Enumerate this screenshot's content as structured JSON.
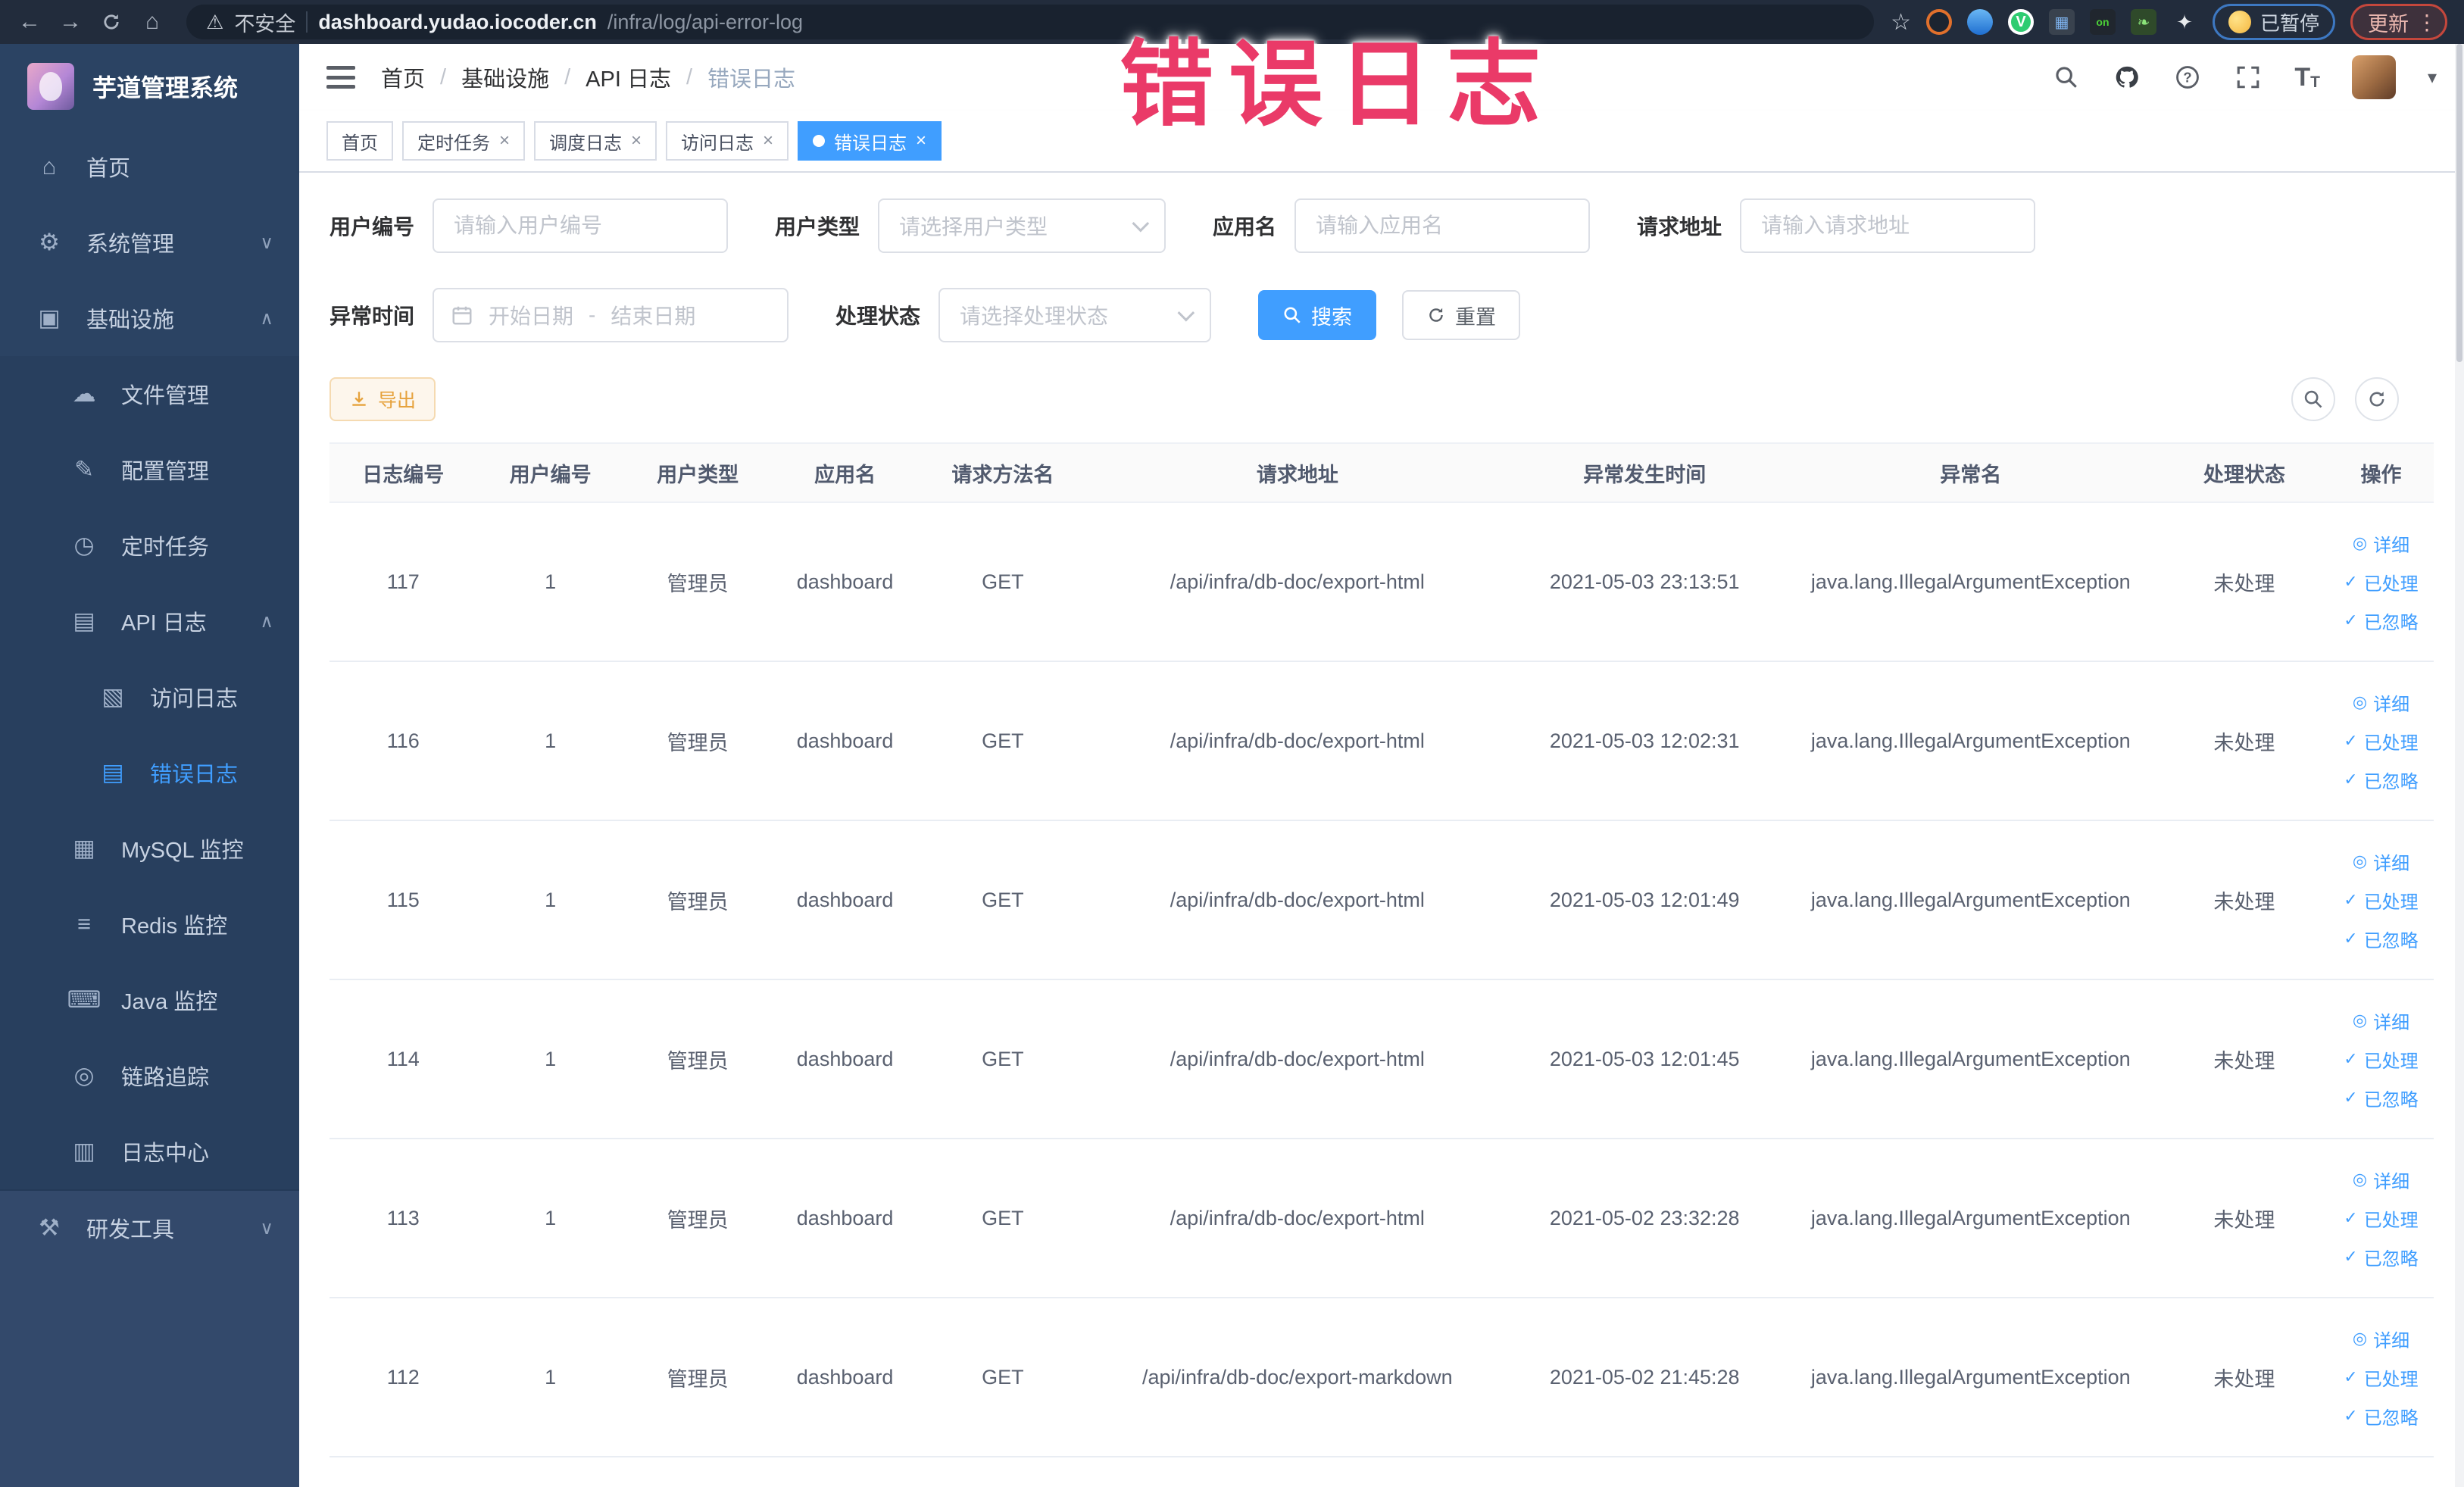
{
  "overlay": {
    "text": "错误日志",
    "color": "#ea3a68"
  },
  "colors": {
    "accent": "#409eff",
    "warning": "#e6a23c",
    "sidebar_bg": "#2b4363",
    "tag_active": "#409eff"
  },
  "browser": {
    "security_label": "不安全",
    "url_host": "dashboard.yudao.iocoder.cn",
    "url_path": "/infra/log/api-error-log",
    "paused_label": "已暂停",
    "update_label": "更新",
    "extension_badge": "on"
  },
  "sidebar": {
    "app_title": "芋道管理系统",
    "items": [
      {
        "key": "home",
        "label": "首页",
        "level": 0
      },
      {
        "key": "system-manage",
        "label": "系统管理",
        "level": 0,
        "arrow": "down"
      },
      {
        "key": "infra",
        "label": "基础设施",
        "level": 0,
        "arrow": "up"
      },
      {
        "key": "file-manage",
        "label": "文件管理",
        "level": 1
      },
      {
        "key": "config-manage",
        "label": "配置管理",
        "level": 1
      },
      {
        "key": "cron-job",
        "label": "定时任务",
        "level": 1
      },
      {
        "key": "api-log",
        "label": "API 日志",
        "level": 1,
        "arrow": "up"
      },
      {
        "key": "access-log",
        "label": "访问日志",
        "level": 2
      },
      {
        "key": "error-log",
        "label": "错误日志",
        "level": 2,
        "active": true
      },
      {
        "key": "mysql-monitor",
        "label": "MySQL 监控",
        "level": 1
      },
      {
        "key": "redis-monitor",
        "label": "Redis 监控",
        "level": 1
      },
      {
        "key": "java-monitor",
        "label": "Java 监控",
        "level": 1
      },
      {
        "key": "trace",
        "label": "链路追踪",
        "level": 1
      },
      {
        "key": "log-center",
        "label": "日志中心",
        "level": 1
      },
      {
        "key": "dev-tools",
        "label": "研发工具",
        "level": 0,
        "arrow": "down",
        "light": true
      }
    ]
  },
  "header": {
    "breadcrumb": [
      "首页",
      "基础设施",
      "API 日志",
      "错误日志"
    ]
  },
  "tabs": [
    {
      "label": "首页",
      "closable": false,
      "active": false
    },
    {
      "label": "定时任务",
      "closable": true,
      "active": false
    },
    {
      "label": "调度日志",
      "closable": true,
      "active": false
    },
    {
      "label": "访问日志",
      "closable": true,
      "active": false
    },
    {
      "label": "错误日志",
      "closable": true,
      "active": true
    }
  ],
  "filters": {
    "user_id": {
      "label": "用户编号",
      "placeholder": "请输入用户编号"
    },
    "user_type": {
      "label": "用户类型",
      "placeholder": "请选择用户类型"
    },
    "app_name": {
      "label": "应用名",
      "placeholder": "请输入应用名"
    },
    "request_url": {
      "label": "请求地址",
      "placeholder": "请输入请求地址"
    },
    "exception_time": {
      "label": "异常时间",
      "start_placeholder": "开始日期",
      "separator": "-",
      "end_placeholder": "结束日期"
    },
    "process_status": {
      "label": "处理状态",
      "placeholder": "请选择处理状态"
    },
    "search_label": "搜索",
    "reset_label": "重置"
  },
  "toolbar": {
    "export_label": "导出"
  },
  "table": {
    "columns": [
      "日志编号",
      "用户编号",
      "用户类型",
      "应用名",
      "请求方法名",
      "请求地址",
      "异常发生时间",
      "异常名",
      "处理状态",
      "操作"
    ],
    "row_actions": [
      "详细",
      "已处理",
      "已忽略"
    ],
    "rows": [
      {
        "log_id": "117",
        "user_id": "1",
        "user_type": "管理员",
        "app_name": "dashboard",
        "method": "GET",
        "url": "/api/infra/db-doc/export-html",
        "time": "2021-05-03 23:13:51",
        "exception": "java.lang.IllegalArgumentException",
        "status": "未处理"
      },
      {
        "log_id": "116",
        "user_id": "1",
        "user_type": "管理员",
        "app_name": "dashboard",
        "method": "GET",
        "url": "/api/infra/db-doc/export-html",
        "time": "2021-05-03 12:02:31",
        "exception": "java.lang.IllegalArgumentException",
        "status": "未处理"
      },
      {
        "log_id": "115",
        "user_id": "1",
        "user_type": "管理员",
        "app_name": "dashboard",
        "method": "GET",
        "url": "/api/infra/db-doc/export-html",
        "time": "2021-05-03 12:01:49",
        "exception": "java.lang.IllegalArgumentException",
        "status": "未处理"
      },
      {
        "log_id": "114",
        "user_id": "1",
        "user_type": "管理员",
        "app_name": "dashboard",
        "method": "GET",
        "url": "/api/infra/db-doc/export-html",
        "time": "2021-05-03 12:01:45",
        "exception": "java.lang.IllegalArgumentException",
        "status": "未处理"
      },
      {
        "log_id": "113",
        "user_id": "1",
        "user_type": "管理员",
        "app_name": "dashboard",
        "method": "GET",
        "url": "/api/infra/db-doc/export-html",
        "time": "2021-05-02 23:32:28",
        "exception": "java.lang.IllegalArgumentException",
        "status": "未处理"
      },
      {
        "log_id": "112",
        "user_id": "1",
        "user_type": "管理员",
        "app_name": "dashboard",
        "method": "GET",
        "url": "/api/infra/db-doc/export-markdown",
        "time": "2021-05-02 21:45:28",
        "exception": "java.lang.IllegalArgumentException",
        "status": "未处理"
      }
    ]
  }
}
